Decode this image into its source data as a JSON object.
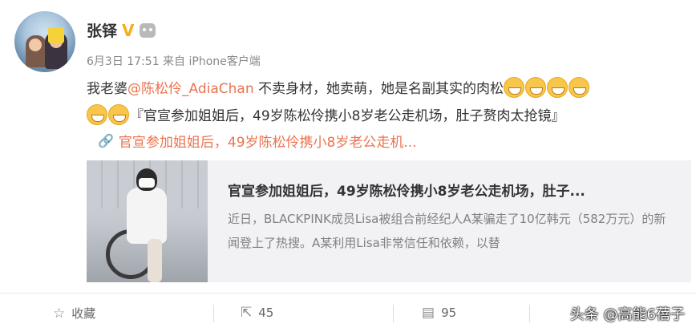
{
  "author": {
    "name": "张铎",
    "verified_mark": "V"
  },
  "post": {
    "meta": "6月3日 17:51 来自 iPhone客户端",
    "text_before": "我老婆",
    "mention": "@陈松伶_AdiaChan",
    "text_after": " 不卖身材，她卖萌，她是名副其实的肉松",
    "text_line2": "『官宣参加姐姐后，49岁陈松伶携小8岁老公走机场，肚子赘肉太抢镜』",
    "link_text": "官宣参加姐姐后，49岁陈松伶携小8岁老公走机...",
    "emoji_name": "grin-emoji"
  },
  "card": {
    "title": "官宣参加姐姐后，49岁陈松伶携小8岁老公走机场，肚子...",
    "desc": "近日，BLACKPINK成员Lisa被组合前经纪人A某骗走了10亿韩元（582万元）的新闻登上了热搜。A某利用Lisa非常信任和依赖，以替"
  },
  "actions": {
    "favorite_label": "收藏",
    "repost_count": "45",
    "comment_count": "95"
  },
  "watermark": "头条 @高能6蓓子"
}
